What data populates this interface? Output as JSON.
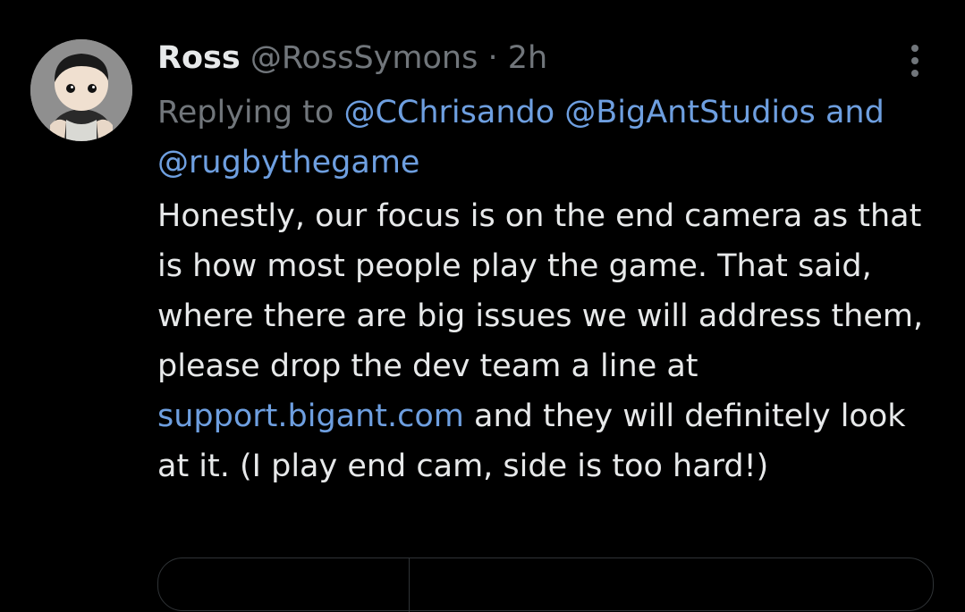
{
  "tweet": {
    "author_name": "Ross",
    "author_handle": "@RossSymons",
    "separator": "·",
    "time": "2h",
    "replying_to_label": "Replying to",
    "reply_mention_1": "@CChrisando",
    "reply_mention_2": "@BigAntStudios",
    "reply_and": "and",
    "reply_mention_3": "@rugbythegame",
    "body_part1": "Honestly, our focus is on the end camera as that is how most people play the game. That said, where there are big issues we will address them, please drop the dev team a line at ",
    "body_link": "support.bigant.com",
    "body_part2": " and they will definitely look at it. (I play end cam, side is too hard!)",
    "avatar_icon": "funko-avatar-icon",
    "more_icon": "more-vertical-icon"
  },
  "colors": {
    "background": "#000000",
    "text_primary": "#e7e9ea",
    "text_secondary": "#71767b",
    "link": "#6e9fe0",
    "border": "#2f3336"
  }
}
